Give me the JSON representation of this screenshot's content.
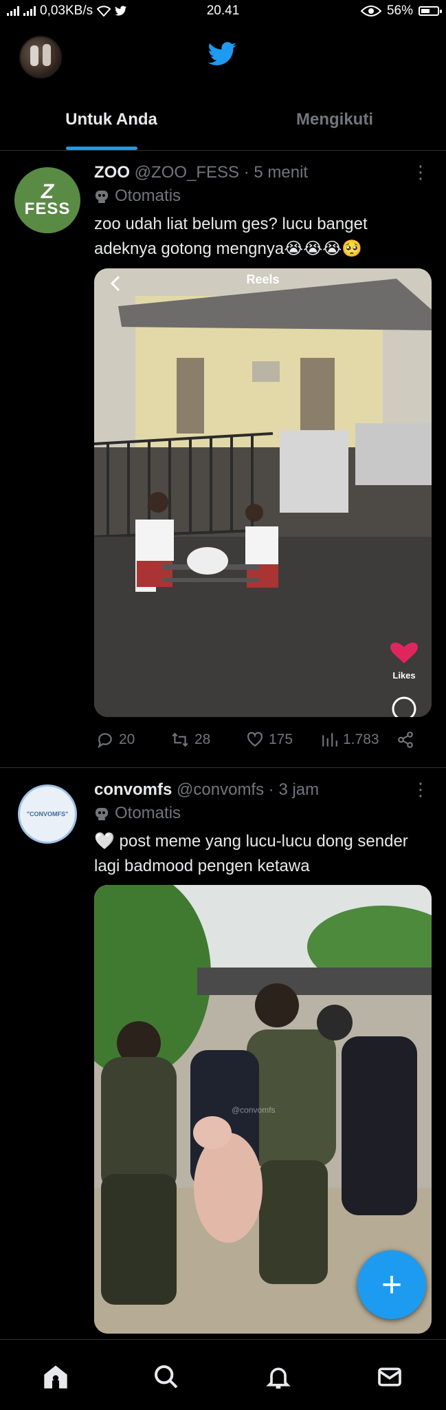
{
  "status_bar": {
    "network_speed": "0,03KB/s",
    "time": "20.41",
    "battery": "56%"
  },
  "tabs": [
    {
      "label": "Untuk Anda",
      "active": true
    },
    {
      "label": "Mengikuti",
      "active": false
    }
  ],
  "tweets": [
    {
      "display_name": "ZOO",
      "handle": "@ZOO_FESS",
      "time": "· 5 menit",
      "automated_label": "Otomatis",
      "avatar_text_1": "Z",
      "avatar_text_2": "FESS",
      "text": "zoo udah liat belum ges? lucu banget adeknya gotong mengnya😭😭😭🥺",
      "media": {
        "reels_title": "Reels",
        "likes_label": "Likes"
      },
      "replies": "20",
      "retweets": "28",
      "likes": "175",
      "views": "1.783"
    },
    {
      "display_name": "convomfs",
      "handle": "@convomfs",
      "time": "· 3 jam",
      "automated_label": "Otomatis",
      "avatar_text": "\"CONVOMFS\"",
      "text": "🤍 post meme yang lucu-lucu dong sender lagi badmood pengen ketawa",
      "media": {
        "watermark": "@convomfs"
      }
    }
  ],
  "fab_label": "+",
  "bottom_nav": [
    "home-icon",
    "search-icon",
    "notifications-icon",
    "messages-icon"
  ],
  "colors": {
    "accent": "#1d9bf0",
    "background": "#000000",
    "text_primary": "#e7e9ea",
    "text_secondary": "#71767b",
    "divider": "#2f3336"
  }
}
